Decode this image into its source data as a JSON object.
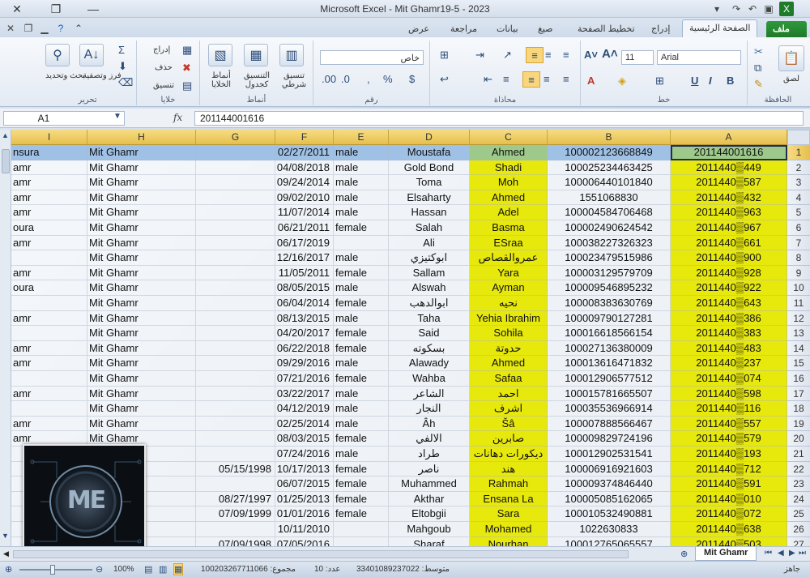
{
  "window": {
    "title": "Microsoft Excel - Mit Ghamr19-5 - 2023"
  },
  "tabs": [
    "ملف",
    "الصفحة الرئيسية",
    "إدراج",
    "تخطيط الصفحة",
    "صيغ",
    "بيانات",
    "مراجعة",
    "عرض"
  ],
  "ribbon": {
    "groups": {
      "clipboard": "الحافظة",
      "font": "خط",
      "alignment": "محاذاة",
      "number": "رقم",
      "styles": "أنماط",
      "cells": "خلايا",
      "editing": "تحرير"
    },
    "paste_label": "لصق",
    "font_name": "Arial",
    "font_size": "11",
    "number_format": "خاص",
    "conditional_label": "تنسيق شرطي",
    "table_format_label": "التنسيق كجدول",
    "cell_styles_label": "أنماط الخلايا",
    "insert_label": "إدراج",
    "delete_label": "حذف",
    "format_label": "تنسيق",
    "sort_label": "فرز وتصفية",
    "find_label": "بحث وتحديد"
  },
  "formula_bar": {
    "name_box": "A1",
    "fx": "fx",
    "value": "201144001616"
  },
  "grid": {
    "columns": [
      "I",
      "H",
      "G",
      "F",
      "E",
      "D",
      "C",
      "B",
      "A"
    ],
    "rows": [
      {
        "n": "1",
        "I": "nsura",
        "H": "Mit Ghamr",
        "G": "",
        "F": "02/27/2011",
        "E": "male",
        "D": "Moustafa",
        "C": "Ahmed",
        "B": "100002123668849",
        "A": "201144001616"
      },
      {
        "n": "2",
        "I": "amr",
        "H": "Mit Ghamr",
        "G": "",
        "F": "04/08/2018",
        "E": "male",
        "D": "Gold Bond",
        "C": "Shadi",
        "B": "100025234463425",
        "A": "2011440▒449"
      },
      {
        "n": "3",
        "I": "amr",
        "H": "Mit Ghamr",
        "G": "",
        "F": "09/24/2014",
        "E": "male",
        "D": "Toma",
        "C": "Moh",
        "B": "100006440101840",
        "A": "2011440▒587"
      },
      {
        "n": "4",
        "I": "amr",
        "H": "Mit Ghamr",
        "G": "",
        "F": "09/02/2010",
        "E": "male",
        "D": "Elsaharty",
        "C": "Ahmed",
        "B": "1551068830",
        "A": "2011440▒432"
      },
      {
        "n": "5",
        "I": "amr",
        "H": "Mit Ghamr",
        "G": "",
        "F": "11/07/2014",
        "E": "male",
        "D": "Hassan",
        "C": "Adel",
        "B": "100004584706468",
        "A": "2011440▒963"
      },
      {
        "n": "6",
        "I": "oura",
        "H": "Mit Ghamr",
        "G": "",
        "F": "06/21/2011",
        "E": "female",
        "D": "Salah",
        "C": "Basma",
        "B": "100002490624542",
        "A": "2011440▒967"
      },
      {
        "n": "7",
        "I": "amr",
        "H": "Mit Ghamr",
        "G": "",
        "F": "06/17/2019",
        "E": "",
        "D": "Ali",
        "C": "ESraa",
        "B": "100038227326323",
        "A": "2011440▒661"
      },
      {
        "n": "8",
        "I": "",
        "H": "Mit Ghamr",
        "G": "",
        "F": "12/16/2017",
        "E": "male",
        "D": "ابوكتيزي",
        "C": "عمروالقصاص",
        "B": "100023479515986",
        "A": "2011440▒900"
      },
      {
        "n": "9",
        "I": "amr",
        "H": "Mit Ghamr",
        "G": "",
        "F": "11/05/2011",
        "E": "female",
        "D": "Sallam",
        "C": "Yara",
        "B": "100003129579709",
        "A": "2011440▒928"
      },
      {
        "n": "10",
        "I": "oura",
        "H": "Mit Ghamr",
        "G": "",
        "F": "08/05/2015",
        "E": "male",
        "D": "Alswah",
        "C": "Ayman",
        "B": "100009546895232",
        "A": "2011440▒922"
      },
      {
        "n": "11",
        "I": "",
        "H": "Mit Ghamr",
        "G": "",
        "F": "06/04/2014",
        "E": "female",
        "D": "ابوالدهب",
        "C": "نحيه",
        "B": "100008383630769",
        "A": "2011440▒643"
      },
      {
        "n": "12",
        "I": "amr",
        "H": "Mit Ghamr",
        "G": "",
        "F": "08/13/2015",
        "E": "male",
        "D": "Taha",
        "C": "Yehia Ibrahim",
        "B": "100009790127281",
        "A": "2011440▒386"
      },
      {
        "n": "13",
        "I": "",
        "H": "Mit Ghamr",
        "G": "",
        "F": "04/20/2017",
        "E": "female",
        "D": "Said",
        "C": "Sohila",
        "B": "100016618566154",
        "A": "2011440▒383"
      },
      {
        "n": "14",
        "I": "amr",
        "H": "Mit Ghamr",
        "G": "",
        "F": "06/22/2018",
        "E": "female",
        "D": "بسكوته",
        "C": "حدوتة",
        "B": "100027136380009",
        "A": "2011440▒483"
      },
      {
        "n": "15",
        "I": "amr",
        "H": "Mit Ghamr",
        "G": "",
        "F": "09/29/2016",
        "E": "male",
        "D": "Alawady",
        "C": "Ahmed",
        "B": "100013616471832",
        "A": "2011440▒237"
      },
      {
        "n": "16",
        "I": "",
        "H": "Mit Ghamr",
        "G": "",
        "F": "07/21/2016",
        "E": "female",
        "D": "Wahba",
        "C": "Safaa",
        "B": "100012906577512",
        "A": "2011440▒074"
      },
      {
        "n": "17",
        "I": "amr",
        "H": "Mit Ghamr",
        "G": "",
        "F": "03/22/2017",
        "E": "male",
        "D": "الشاعر",
        "C": "احمد",
        "B": "100015781665507",
        "A": "2011440▒598"
      },
      {
        "n": "18",
        "I": "",
        "H": "Mit Ghamr",
        "G": "",
        "F": "04/12/2019",
        "E": "male",
        "D": "النجار",
        "C": "اشرف",
        "B": "100035536966914",
        "A": "2011440▒116"
      },
      {
        "n": "19",
        "I": "amr",
        "H": "Mit Ghamr",
        "G": "",
        "F": "02/25/2014",
        "E": "male",
        "D": "Âh",
        "C": "Šâ",
        "B": "100007888566467",
        "A": "2011440▒557"
      },
      {
        "n": "20",
        "I": "amr",
        "H": "Mit Ghamr",
        "G": "",
        "F": "08/03/2015",
        "E": "female",
        "D": "الالفي",
        "C": "صابرين",
        "B": "100009829724196",
        "A": "2011440▒579"
      },
      {
        "n": "21",
        "I": "",
        "H": "",
        "G": "",
        "F": "07/24/2016",
        "E": "male",
        "D": "طراد",
        "C": "ديكورات دهانات",
        "B": "100012902531541",
        "A": "2011440▒193"
      },
      {
        "n": "22",
        "I": "",
        "H": "",
        "G": "05/15/1998",
        "F": "10/17/2013",
        "E": "female",
        "D": "ناصر",
        "C": "هند",
        "B": "100006916921603",
        "A": "2011440▒712"
      },
      {
        "n": "23",
        "I": "",
        "H": "",
        "G": "",
        "F": "06/07/2015",
        "E": "female",
        "D": "Muhammed",
        "C": "Rahmah",
        "B": "100009374846440",
        "A": "2011440▒591"
      },
      {
        "n": "24",
        "I": "",
        "H": "",
        "G": "08/27/1997",
        "F": "01/25/2013",
        "E": "female",
        "D": "Akthar",
        "C": "Ensana La",
        "B": "100005085162065",
        "A": "2011440▒010"
      },
      {
        "n": "25",
        "I": "",
        "H": "",
        "G": "07/09/1999",
        "F": "01/01/2016",
        "E": "female",
        "D": "Eltobgii",
        "C": "Sara",
        "B": "100010532490881",
        "A": "2011440▒072"
      },
      {
        "n": "26",
        "I": "",
        "H": "",
        "G": "",
        "F": "10/11/2010",
        "E": "",
        "D": "Mahgoub",
        "C": "Mohamed",
        "B": "1022630833",
        "A": "2011440▒638"
      },
      {
        "n": "27",
        "I": "",
        "H": "",
        "G": "07/09/1998",
        "F": "07/05/2016",
        "E": "",
        "D": "Sharaf",
        "C": "Nourhan",
        "B": "100012765065557",
        "A": "2011440▒503"
      }
    ]
  },
  "sheet_tabs": [
    "Mit Ghamr"
  ],
  "status": {
    "ready": "جاهز",
    "average": "متوسط: 33401089237022",
    "count": "عدد: 10",
    "sum": "مجموع: 100203267711066",
    "zoom": "100%"
  },
  "logo_text": "ME",
  "colors": {
    "highlight": "#e7e80c",
    "header": "#e6c04c",
    "selection": "#9fc1e6",
    "file_tab": "#1f7a2a"
  }
}
